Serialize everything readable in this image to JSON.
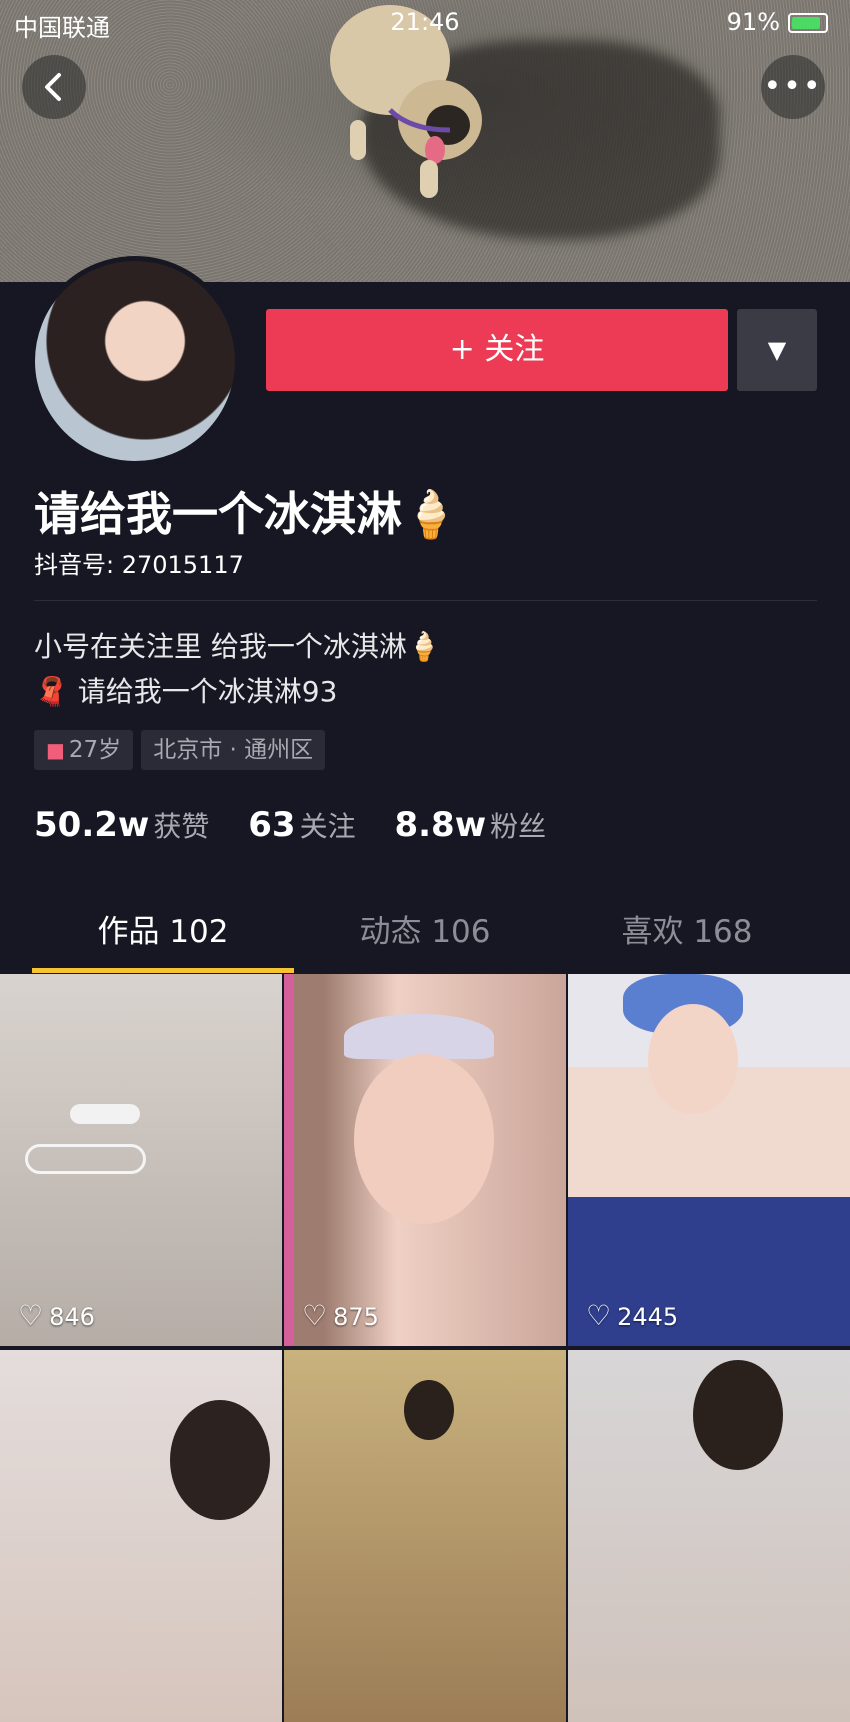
{
  "status_bar": {
    "carrier": "中国联通",
    "time": "21:46",
    "battery": "91%"
  },
  "header": {
    "more_label": "•••"
  },
  "profile": {
    "follow_label": "+ 关注",
    "dropdown_label": "▼",
    "nickname": "请给我一个冰淇淋🍦",
    "douyin_id": "抖音号: 27015117",
    "bio_line1": "小号在关注里 给我一个冰淇淋🍦",
    "bio_line2": "🧣 请给我一个冰淇淋93",
    "tags": {
      "age": "27岁",
      "location": "北京市 · 通州区"
    },
    "stats": [
      {
        "value": "50.2w",
        "label": "获赞"
      },
      {
        "value": "63",
        "label": "关注"
      },
      {
        "value": "8.8w",
        "label": "粉丝"
      }
    ]
  },
  "tabs": [
    {
      "label": "作品 102",
      "active": true
    },
    {
      "label": "动态 106",
      "active": false
    },
    {
      "label": "喜欢 168",
      "active": false
    }
  ],
  "videos": [
    {
      "likes": "846"
    },
    {
      "likes": "875"
    },
    {
      "likes": "2445"
    },
    {
      "likes": ""
    },
    {
      "likes": ""
    },
    {
      "likes": ""
    }
  ],
  "colors": {
    "background": "#161722",
    "follow_button": "#ee3b55",
    "tab_indicator": "#f7c32e"
  }
}
